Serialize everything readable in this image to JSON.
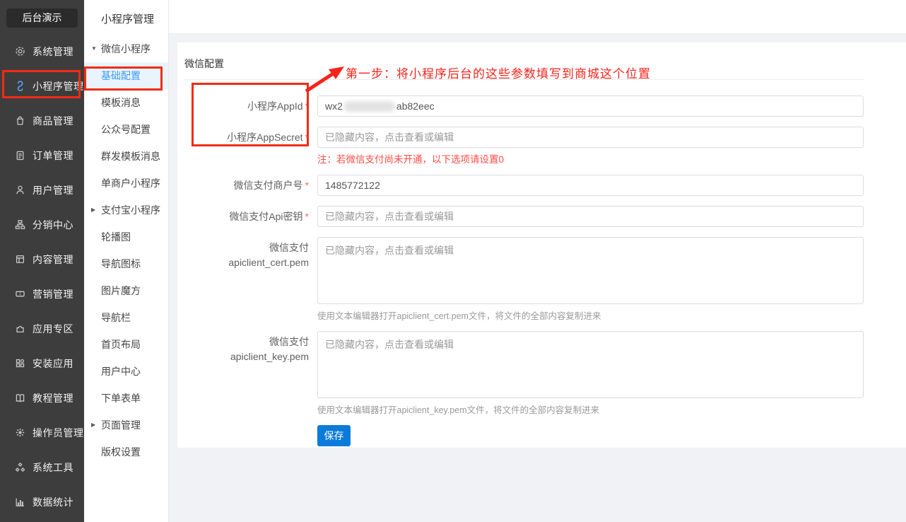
{
  "app": {
    "brand": "后台演示"
  },
  "colors": {
    "sidebar_dark_bg": "#3d3d3d",
    "accent_blue": "#0b7bd9",
    "active_menu_blue": "#3c9cf6",
    "active_menu_bg": "#e9f4fe",
    "annotation_red": "#f22b13",
    "note_red": "#ff4c44"
  },
  "sidebar": {
    "items": [
      {
        "icon": "gear-icon",
        "label": "系统管理"
      },
      {
        "icon": "miniprogram-icon",
        "label": "小程序管理"
      },
      {
        "icon": "bag-icon",
        "label": "商品管理"
      },
      {
        "icon": "order-icon",
        "label": "订单管理"
      },
      {
        "icon": "user-icon",
        "label": "用户管理"
      },
      {
        "icon": "sitemap-icon",
        "label": "分销中心"
      },
      {
        "icon": "content-icon",
        "label": "内容管理"
      },
      {
        "icon": "ticket-icon",
        "label": "营销管理"
      },
      {
        "icon": "puzzle-icon",
        "label": "应用专区"
      },
      {
        "icon": "grid-icon",
        "label": "安装应用"
      },
      {
        "icon": "book-icon",
        "label": "教程管理"
      },
      {
        "icon": "operator-gear-icon",
        "label": "操作员管理"
      },
      {
        "icon": "tools-icon",
        "label": "系统工具"
      },
      {
        "icon": "chart-icon",
        "label": "数据统计"
      }
    ]
  },
  "submenu": {
    "title": "小程序管理",
    "arrow_open": "▼",
    "arrow_closed": "▶",
    "items": [
      {
        "label": "微信小程序"
      },
      {
        "label": "基础配置"
      },
      {
        "label": "模板消息"
      },
      {
        "label": "公众号配置"
      },
      {
        "label": "群发模板消息"
      },
      {
        "label": "单商户小程序"
      },
      {
        "label": "支付宝小程序"
      },
      {
        "label": "轮播图"
      },
      {
        "label": "导航图标"
      },
      {
        "label": "图片魔方"
      },
      {
        "label": "导航栏"
      },
      {
        "label": "首页布局"
      },
      {
        "label": "用户中心"
      },
      {
        "label": "下单表单"
      },
      {
        "label": "页面管理"
      },
      {
        "label": "版权设置"
      }
    ]
  },
  "main": {
    "page_title": "微信配置",
    "annotation_text": "第一步：将小程序后台的这些参数填写到商城这个位置",
    "form": {
      "required_mark": "*",
      "appid": {
        "label": "小程序AppId",
        "value_prefix": "wx2",
        "value_suffix": "ab82eec"
      },
      "appsecret": {
        "label": "小程序AppSecret",
        "value": "已隐藏内容，点击查看或编辑"
      },
      "note": "注：若微信支付尚未开通，以下选项请设置0",
      "mchid": {
        "label": "微信支付商户号",
        "value": "1485772122"
      },
      "apikey": {
        "label": "微信支付Api密钥",
        "value": "已隐藏内容，点击查看或编辑"
      },
      "cert": {
        "label_line1": "微信支付",
        "label_line2": "apiclient_cert.pem",
        "value": "已隐藏内容，点击查看或编辑",
        "help": "使用文本编辑器打开apiclient_cert.pem文件，将文件的全部内容复制进来"
      },
      "key": {
        "label_line1": "微信支付",
        "label_line2": "apiclient_key.pem",
        "value": "已隐藏内容，点击查看或编辑",
        "help": "使用文本编辑器打开apiclient_key.pem文件，将文件的全部内容复制进来"
      },
      "save_label": "保存"
    }
  }
}
